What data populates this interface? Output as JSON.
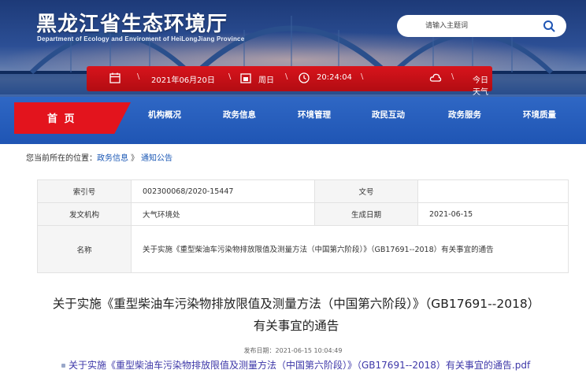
{
  "site": {
    "title": "黑龙江省生态环境厅",
    "subtitle": "Department of Ecology and Enviroment of HeiLongJiang Province"
  },
  "search": {
    "placeholder": "请输入主题词"
  },
  "info_bar": {
    "date": "2021年06月20日",
    "weekday": "周日",
    "time": "20:24:04",
    "weather": "今日天气"
  },
  "nav": {
    "home": "首 页",
    "items": [
      "机构概况",
      "政务信息",
      "环境管理",
      "政民互动",
      "政务服务",
      "环境质量"
    ]
  },
  "breadcrumb": {
    "prefix": "您当前所在的位置：",
    "level1": "政务信息",
    "level2": "通知公告",
    "separator": "》"
  },
  "meta": {
    "index_label": "索引号",
    "index_value": "002300068/2020-15447",
    "docno_label": "文号",
    "docno_value": "",
    "issuer_label": "发文机构",
    "issuer_value": "大气环境处",
    "date_label": "生成日期",
    "date_value": "2021-06-15",
    "name_label": "名称",
    "name_value": "关于实施《重型柴油车污染物排放限值及测量方法（中国第六阶段）》（GB17691--2018）有关事宜的通告"
  },
  "article": {
    "title": "关于实施《重型柴油车污染物排放限值及测量方法（中国第六阶段）》（GB17691--2018）有关事宜的通告",
    "publish_time": "发布日期：2021-06-15 10:04:49",
    "attachment": "关于实施《重型柴油车污染物排放限值及测量方法（中国第六阶段）》（GB17691--2018）有关事宜的通告.pdf"
  },
  "colors": {
    "nav_blue": "#1f55b4",
    "accent_red": "#e3141d",
    "link_blue": "#1a57b5",
    "attachment_link": "#3d37a8"
  }
}
